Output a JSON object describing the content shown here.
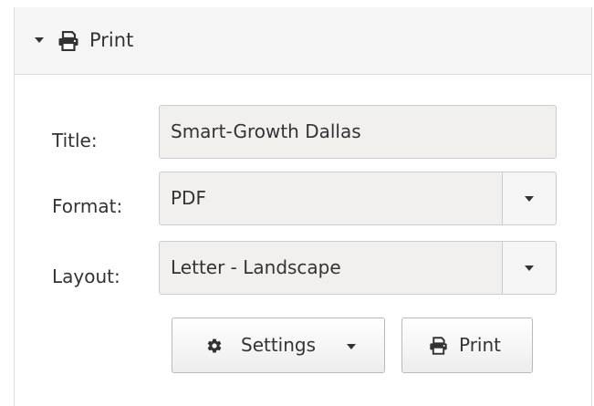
{
  "header": {
    "title": "Print",
    "icon": "print-icon",
    "toggle_icon": "caret-down-icon"
  },
  "form": {
    "title": {
      "label": "Title:",
      "value": "Smart-Growth Dallas"
    },
    "format": {
      "label": "Format:",
      "value": "PDF"
    },
    "layout": {
      "label": "Layout:",
      "value": "Letter - Landscape"
    }
  },
  "buttons": {
    "settings": {
      "label": "Settings",
      "icon": "gear-icon",
      "dropdown_icon": "caret-down-icon"
    },
    "print": {
      "label": "Print",
      "icon": "print-icon"
    }
  },
  "colors": {
    "header_bg": "#f5f5f5",
    "input_bg": "#f2f0ec",
    "border": "#cccccc",
    "text": "#333333"
  }
}
